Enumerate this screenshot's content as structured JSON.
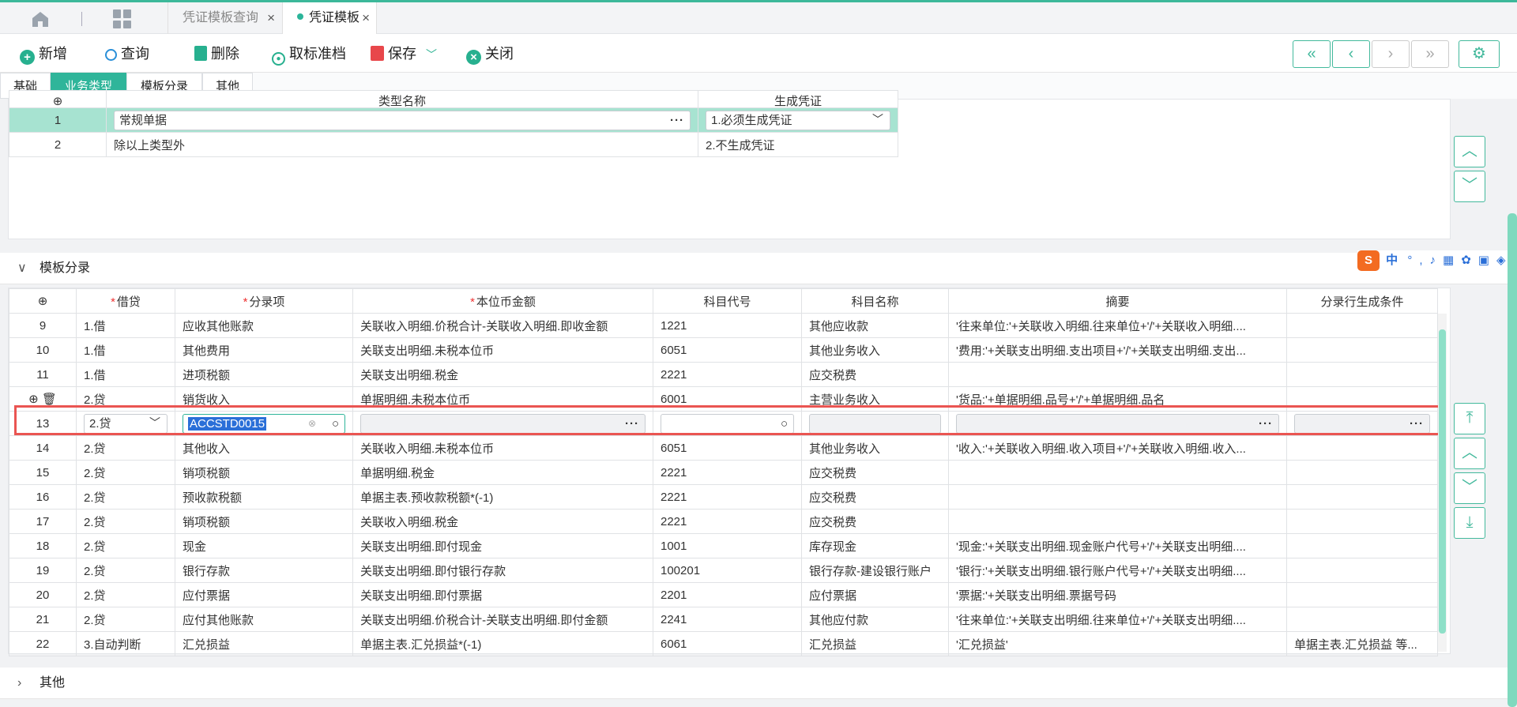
{
  "tabs": [
    {
      "label": "凭证模板查询"
    },
    {
      "label": "凭证模板"
    }
  ],
  "toolbar": {
    "add": "新增",
    "query": "查询",
    "delete": "删除",
    "cancel_std": "取标准档",
    "save": "保存",
    "close": "关闭"
  },
  "subtabs": [
    "基础",
    "业务类型",
    "模板分录",
    "其他"
  ],
  "biz_table": {
    "headers": [
      "类型名称",
      "生成凭证"
    ],
    "rows": [
      {
        "no": "1",
        "name": "常规单据",
        "gen": "1.必须生成凭证"
      },
      {
        "no": "2",
        "name": "除以上类型外",
        "gen": "2.不生成凭证"
      }
    ]
  },
  "section_entries": "模板分录",
  "section_other": "其他",
  "entry_table": {
    "headers": [
      "借贷",
      "分录项",
      "本位币金额",
      "科目代号",
      "科目名称",
      "摘要",
      "分录行生成条件"
    ],
    "rows": [
      {
        "no": "9",
        "dc": "1.借",
        "item": "应收其他账款",
        "amount": "关联收入明细.价税合计-关联收入明细.即收金额",
        "code": "1221",
        "acct": "其他应收款",
        "memo": "'往来单位:'+关联收入明细.往来单位+'/'+关联收入明细....",
        "cond": ""
      },
      {
        "no": "10",
        "dc": "1.借",
        "item": "其他费用",
        "amount": "关联支出明细.未税本位币",
        "code": "6051",
        "acct": "其他业务收入",
        "memo": "'费用:'+关联支出明细.支出项目+'/'+关联支出明细.支出...",
        "cond": ""
      },
      {
        "no": "11",
        "dc": "1.借",
        "item": "进项税额",
        "amount": "关联支出明细.税金",
        "code": "2221",
        "acct": "应交税费",
        "memo": "",
        "cond": ""
      },
      {
        "no": "",
        "dc": "2.贷",
        "item": "销货收入",
        "amount": "单据明细.未税本位币",
        "code": "6001",
        "acct": "主营业务收入",
        "memo": "'货品:'+单据明细.品号+'/'+单据明细.品名",
        "cond": ""
      },
      {
        "no": "13",
        "dc": "2.贷",
        "item": "ACCSTD0015",
        "amount": "",
        "code": "",
        "acct": "",
        "memo": "",
        "cond": ""
      },
      {
        "no": "14",
        "dc": "2.贷",
        "item": "其他收入",
        "amount": "关联收入明细.未税本位币",
        "code": "6051",
        "acct": "其他业务收入",
        "memo": "'收入:'+关联收入明细.收入项目+'/'+关联收入明细.收入...",
        "cond": ""
      },
      {
        "no": "15",
        "dc": "2.贷",
        "item": "销项税额",
        "amount": "单据明细.税金",
        "code": "2221",
        "acct": "应交税费",
        "memo": "",
        "cond": ""
      },
      {
        "no": "16",
        "dc": "2.贷",
        "item": "预收款税额",
        "amount": "单据主表.预收款税额*(-1)",
        "code": "2221",
        "acct": "应交税费",
        "memo": "",
        "cond": ""
      },
      {
        "no": "17",
        "dc": "2.贷",
        "item": "销项税额",
        "amount": "关联收入明细.税金",
        "code": "2221",
        "acct": "应交税费",
        "memo": "",
        "cond": ""
      },
      {
        "no": "18",
        "dc": "2.贷",
        "item": "现金",
        "amount": "关联支出明细.即付现金",
        "code": "1001",
        "acct": "库存现金",
        "memo": "'现金:'+关联支出明细.现金账户代号+'/'+关联支出明细....",
        "cond": ""
      },
      {
        "no": "19",
        "dc": "2.贷",
        "item": "银行存款",
        "amount": "关联支出明细.即付银行存款",
        "code": "100201",
        "acct": "银行存款-建设银行账户",
        "memo": "'银行:'+关联支出明细.银行账户代号+'/'+关联支出明细....",
        "cond": ""
      },
      {
        "no": "20",
        "dc": "2.贷",
        "item": "应付票据",
        "amount": "关联支出明细.即付票据",
        "code": "2201",
        "acct": "应付票据",
        "memo": "'票据:'+关联支出明细.票据号码",
        "cond": ""
      },
      {
        "no": "21",
        "dc": "2.贷",
        "item": "应付其他账款",
        "amount": "关联支出明细.价税合计-关联支出明细.即付金额",
        "code": "2241",
        "acct": "其他应付款",
        "memo": "'往来单位:'+关联支出明细.往来单位+'/'+关联支出明细....",
        "cond": ""
      },
      {
        "no": "22",
        "dc": "3.自动判断",
        "item": "汇兑损益",
        "amount": "单据主表.汇兑损益*(-1)",
        "code": "6061",
        "acct": "汇兑损益",
        "memo": "'汇兑损益'",
        "cond": "单据主表.汇兑损益 等..."
      }
    ]
  },
  "ime_label": "中",
  "colors": {
    "accent": "#2fb59a",
    "highlight_row": "#a7e3d1",
    "red_box": "#ea5552"
  }
}
